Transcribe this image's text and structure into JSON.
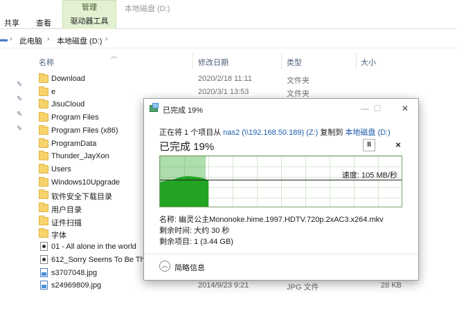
{
  "ribbon": {
    "manage_tab": "管理",
    "title": "本地磁盘 (D:)",
    "tabs": {
      "share": "共享",
      "view": "查看",
      "drive_tools": "驱动器工具"
    }
  },
  "address": {
    "this_pc": "此电脑",
    "drive": "本地磁盘 (D:)"
  },
  "columns": {
    "name": "名称",
    "modified": "修改日期",
    "type": "类型",
    "size": "大小"
  },
  "files": [
    {
      "name": "Download",
      "date": "2020/2/18 11:11",
      "type": "文件夹",
      "size": "",
      "icon": "folder"
    },
    {
      "name": "e",
      "date": "2020/3/1 13:53",
      "type": "文件夹",
      "size": "",
      "icon": "folder"
    },
    {
      "name": "JisuCloud",
      "date": "",
      "type": "",
      "size": "",
      "icon": "folder"
    },
    {
      "name": "Program Files",
      "date": "",
      "type": "",
      "size": "",
      "icon": "folder"
    },
    {
      "name": "Program Files (x86)",
      "date": "",
      "type": "",
      "size": "",
      "icon": "folder"
    },
    {
      "name": "ProgramData",
      "date": "",
      "type": "",
      "size": "",
      "icon": "folder"
    },
    {
      "name": "Thunder_JayXon",
      "date": "",
      "type": "",
      "size": "",
      "icon": "folder"
    },
    {
      "name": "Users",
      "date": "",
      "type": "",
      "size": "",
      "icon": "folder"
    },
    {
      "name": "Windows10Upgrade",
      "date": "",
      "type": "",
      "size": "",
      "icon": "folder"
    },
    {
      "name": "软件安全下载目录",
      "date": "",
      "type": "",
      "size": "",
      "icon": "folder"
    },
    {
      "name": "用户目录",
      "date": "",
      "type": "",
      "size": "",
      "icon": "folder"
    },
    {
      "name": "证件扫描",
      "date": "",
      "type": "",
      "size": "",
      "icon": "folder"
    },
    {
      "name": "字体",
      "date": "",
      "type": "",
      "size": "",
      "icon": "folder"
    },
    {
      "name": "01 - All alone in the world",
      "date": "",
      "type": "",
      "size": "",
      "icon": "mp3"
    },
    {
      "name": "612_Sorry Seems To Be Th",
      "date": "",
      "type": "",
      "size": "",
      "icon": "mp3"
    },
    {
      "name": "s3707048.jpg",
      "date": "",
      "type": "",
      "size": "",
      "icon": "jpg"
    },
    {
      "name": "s24969809.jpg",
      "date": "2014/9/23 9:21",
      "type": "JPG 文件",
      "size": "28 KB",
      "icon": "jpg"
    }
  ],
  "dialog": {
    "title": "已完成 19%",
    "line1_prefix": "正在将 1 个项目从 ",
    "source": "nas2 (\\\\192.168.50.189) (Z:)",
    "line1_mid": " 复制到 ",
    "dest": "本地磁盘 (D:)",
    "progress_text": "已完成 19%",
    "progress_fraction": 0.19,
    "pause_symbol": "II",
    "stop_symbol": "×",
    "speed": "速度: 105 MB/秒",
    "name_line": "名称: 幽灵公主Mononoke.hime.1997.HDTV.720p.2xAC3.x264.mkv",
    "time_left": "剩余时间: 大约 30 秒",
    "items_left": "剩余项目: 1 (3.44 GB)",
    "details_label": "简略信息",
    "win_min": "—",
    "win_max": "☐",
    "win_close": "✕"
  }
}
